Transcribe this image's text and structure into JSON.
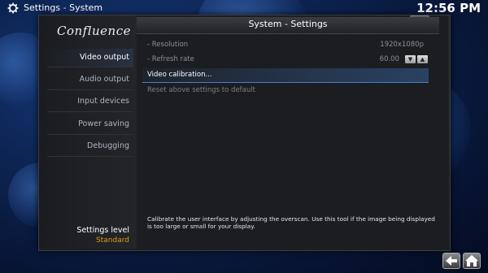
{
  "topbar": {
    "section": "Settings",
    "separator": " - ",
    "page": "System",
    "clock": "12:56 PM"
  },
  "window": {
    "close_label": "×"
  },
  "sidebar": {
    "logo": "Confluence",
    "items": [
      {
        "label": "Video output"
      },
      {
        "label": "Audio output"
      },
      {
        "label": "Input devices"
      },
      {
        "label": "Power saving"
      },
      {
        "label": "Debugging"
      }
    ],
    "level_label": "Settings level",
    "level_value": "Standard"
  },
  "content": {
    "title": "System - Settings",
    "rows": [
      {
        "label": "- Resolution",
        "value": "1920x1080p"
      },
      {
        "label": "- Refresh rate",
        "value": "60.00"
      },
      {
        "label": "Video calibration..."
      },
      {
        "label": "Reset above settings to default"
      }
    ],
    "description": "Calibrate the user interface by adjusting the overscan. Use this tool if the image being displayed is too large or small for your display."
  },
  "icons": {
    "gear": "gear-icon",
    "spin_down": "▼",
    "spin_up": "▲",
    "back": "back-arrow-icon",
    "home": "home-icon"
  },
  "colors": {
    "accent": "#e39a12",
    "highlight": "#4a7fd0",
    "background": "#0d2452"
  }
}
